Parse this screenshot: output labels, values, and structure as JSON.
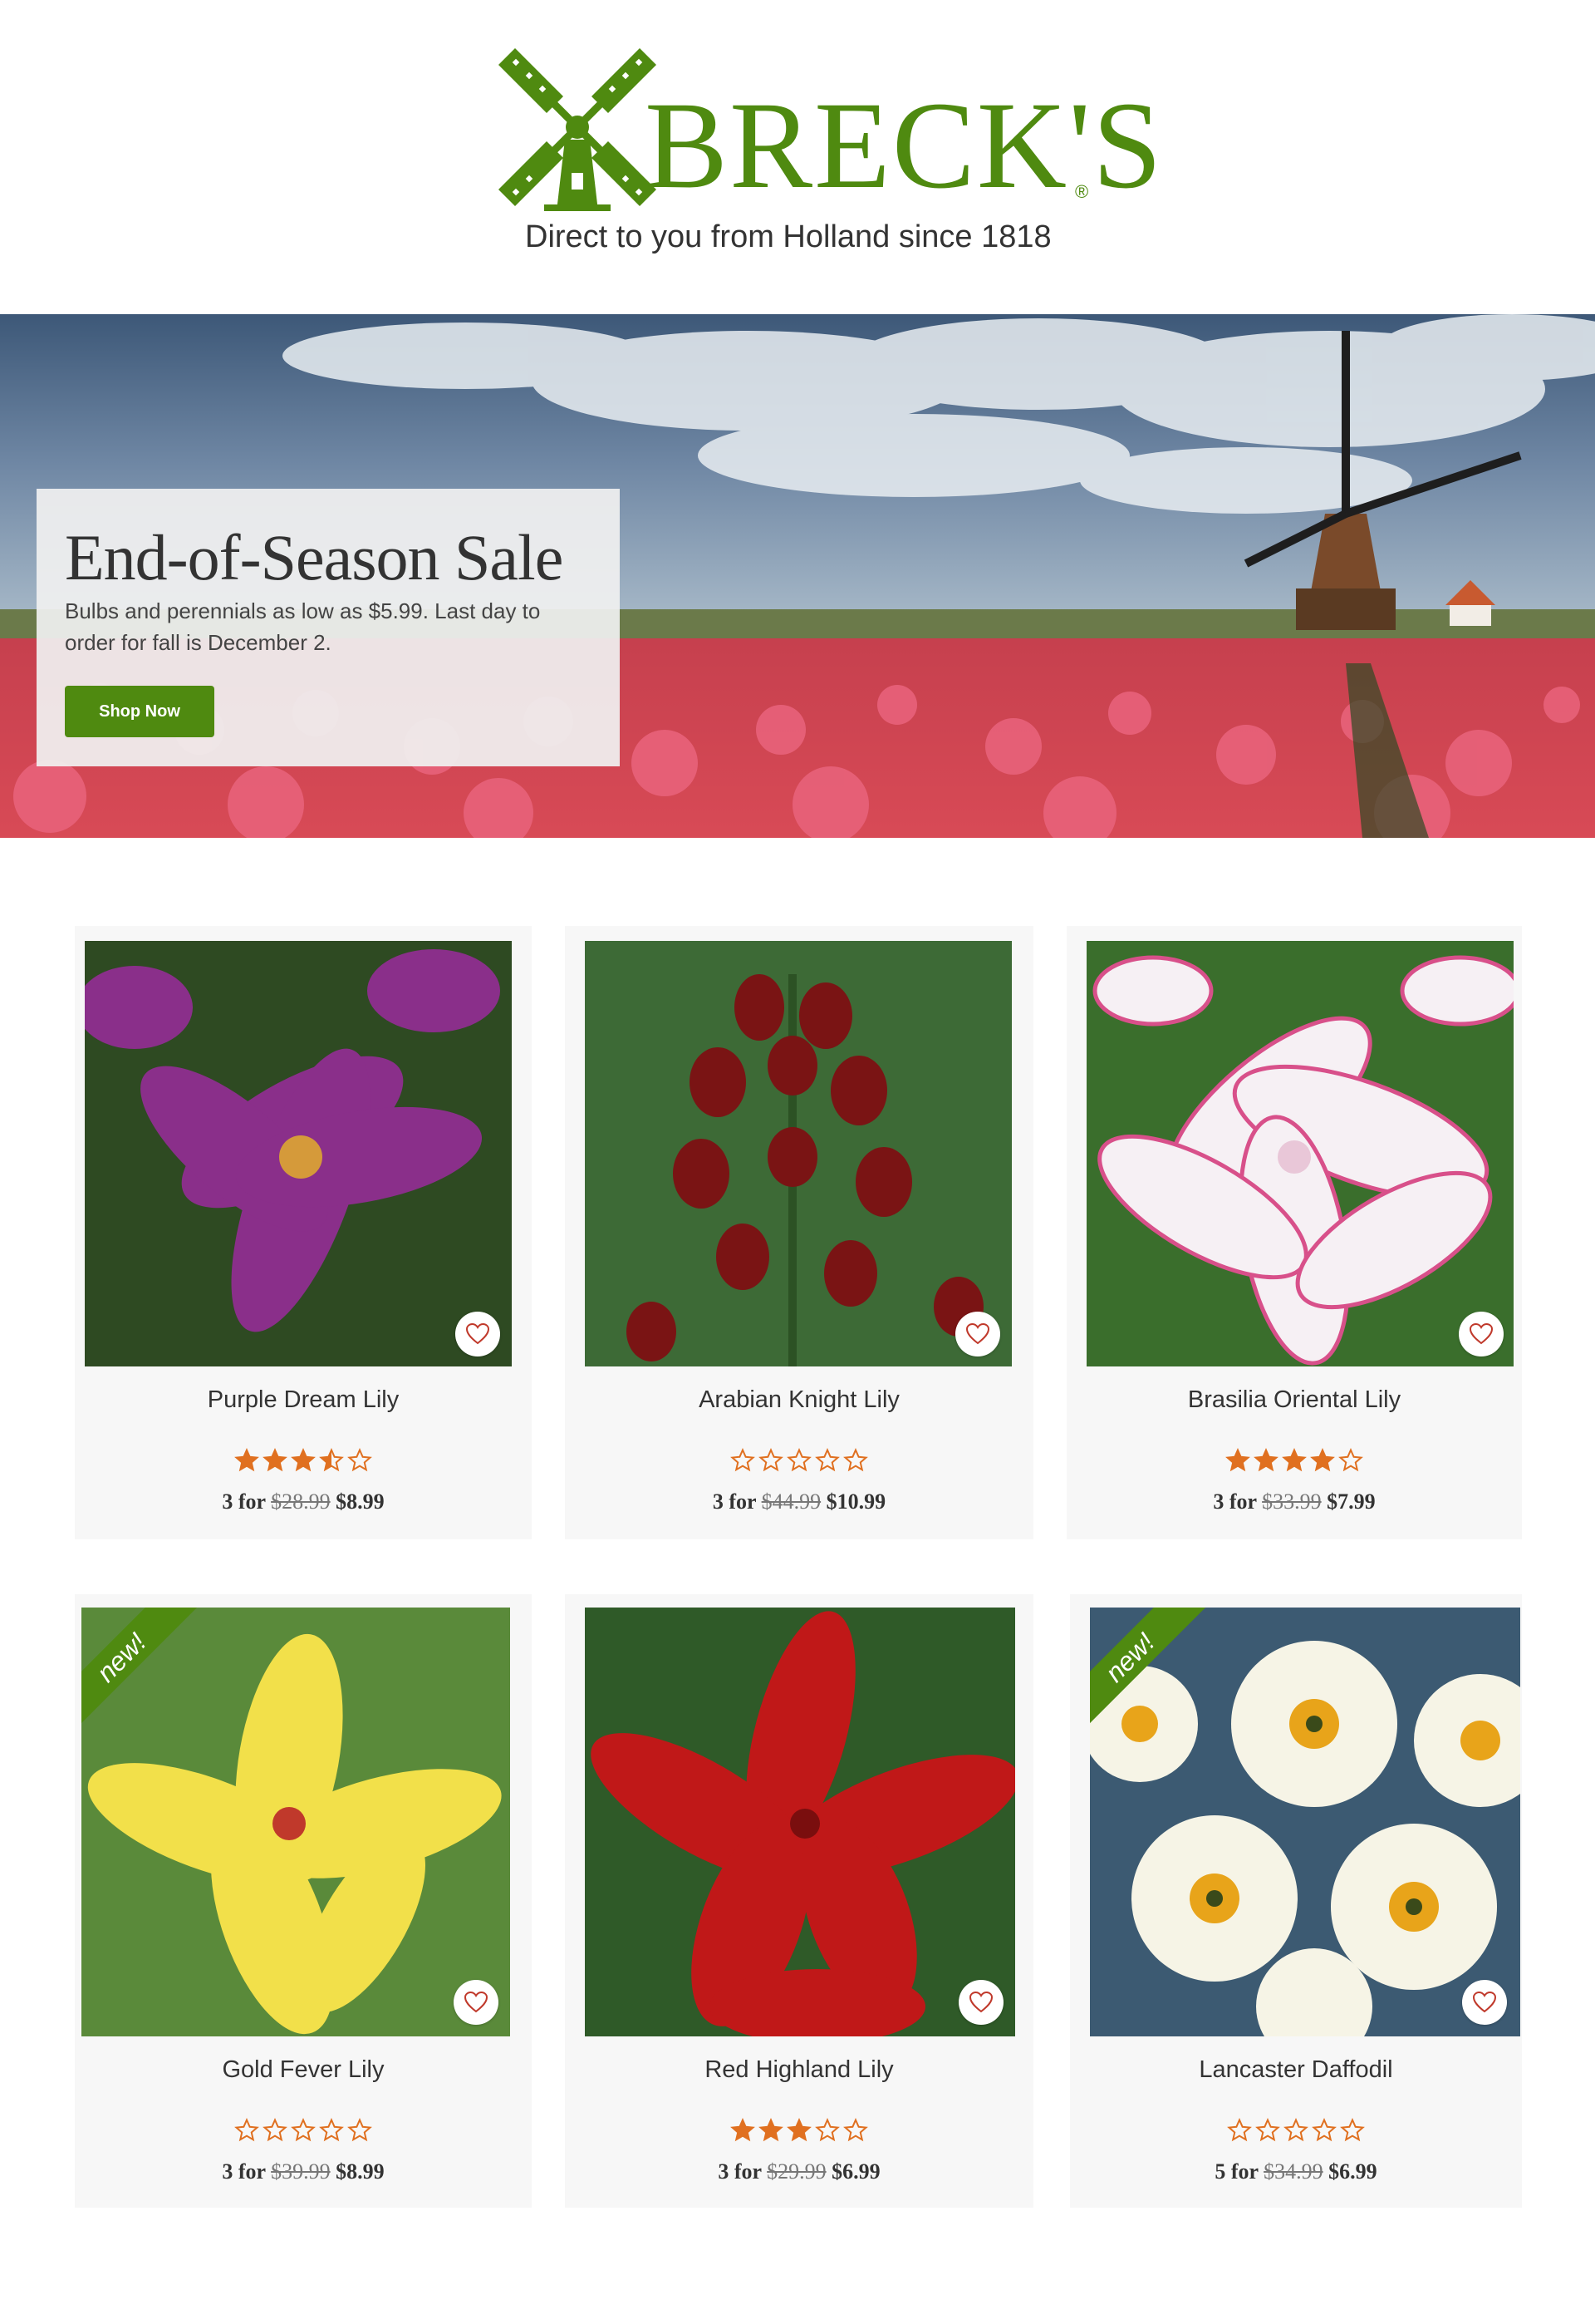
{
  "brand": {
    "name": "BRECK'S",
    "registered": "®",
    "tagline": "Direct to you from Holland since 1818"
  },
  "hero": {
    "title": "End-of-Season Sale",
    "text": "Bulbs and perennials as low as $5.99. Last day to order for fall is December 2.",
    "button": "Shop Now"
  },
  "products": [
    {
      "name": "Purple Dream Lily",
      "rating": 3.5,
      "qty": "3 for",
      "was": "$28.99",
      "now": "$8.99",
      "is_new": false,
      "badge": ""
    },
    {
      "name": "Arabian Knight Lily",
      "rating": 0,
      "qty": "3 for",
      "was": "$44.99",
      "now": "$10.99",
      "is_new": false,
      "badge": ""
    },
    {
      "name": "Brasilia Oriental Lily",
      "rating": 4,
      "qty": "3 for",
      "was": "$33.99",
      "now": "$7.99",
      "is_new": false,
      "badge": ""
    },
    {
      "name": "Gold Fever Lily",
      "rating": 0,
      "qty": "3 for",
      "was": "$39.99",
      "now": "$8.99",
      "is_new": true,
      "badge": "new!"
    },
    {
      "name": "Red Highland Lily",
      "rating": 3,
      "qty": "3 for",
      "was": "$29.99",
      "now": "$6.99",
      "is_new": false,
      "badge": ""
    },
    {
      "name": "Lancaster Daffodil",
      "rating": 0,
      "qty": "5 for",
      "was": "$34.99",
      "now": "$6.99",
      "is_new": true,
      "badge": "new!"
    }
  ],
  "colors": {
    "brand_green": "#4f8a10",
    "star_orange": "#e07020",
    "card_bg": "#f7f7f7"
  },
  "icons": {
    "logo": "windmill-icon",
    "wishlist": "heart-icon",
    "rating": "star-icon"
  }
}
